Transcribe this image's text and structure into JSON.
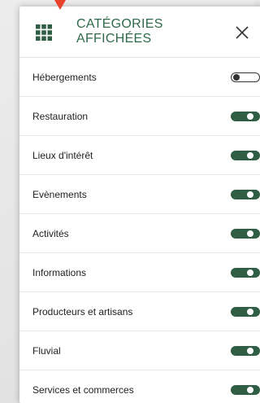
{
  "panel": {
    "title_line1": "CATÉGORIES",
    "title_line2": "AFFICHÉES",
    "grid_icon": "grid-icon",
    "close_icon": "close-icon",
    "accent_color": "#2f6a4a",
    "pointer_color": "#e8412c"
  },
  "categories": [
    {
      "label": "Hébergements",
      "enabled": false
    },
    {
      "label": "Restauration",
      "enabled": true
    },
    {
      "label": "Lieux d'intérêt",
      "enabled": true
    },
    {
      "label": "Evènements",
      "enabled": true
    },
    {
      "label": "Activités",
      "enabled": true
    },
    {
      "label": "Informations",
      "enabled": true
    },
    {
      "label": "Producteurs et artisans",
      "enabled": true
    },
    {
      "label": "Fluvial",
      "enabled": true
    },
    {
      "label": "Services et commerces",
      "enabled": true
    }
  ]
}
